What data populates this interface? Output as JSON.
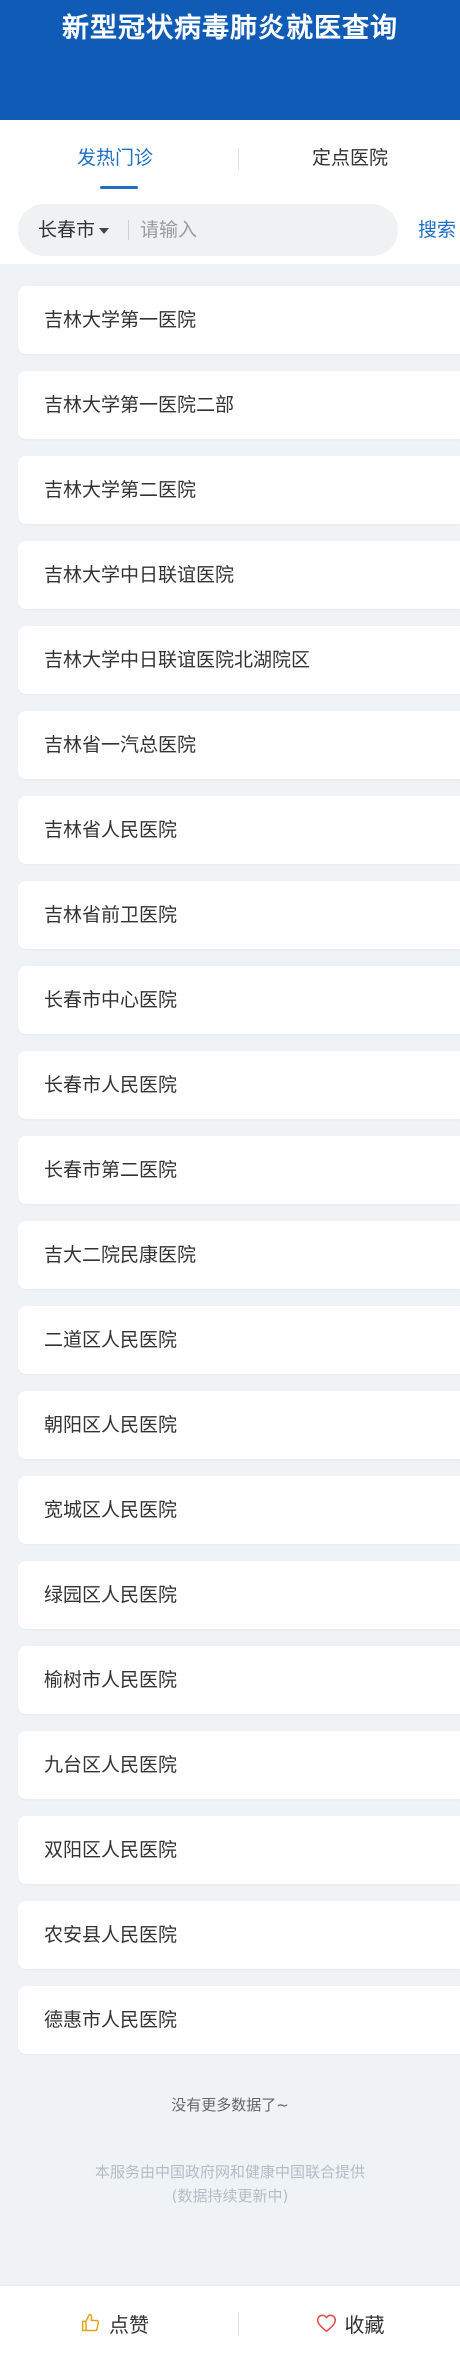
{
  "header": {
    "title": "新型冠状病毒肺炎就医查询"
  },
  "tabs": [
    {
      "label": "发热门诊",
      "active": true
    },
    {
      "label": "定点医院",
      "active": false
    }
  ],
  "search": {
    "city": "长春市",
    "placeholder": "请输入",
    "button_label": "搜索"
  },
  "hospitals": [
    "吉林大学第一医院",
    "吉林大学第一医院二部",
    "吉林大学第二医院",
    "吉林大学中日联谊医院",
    "吉林大学中日联谊医院北湖院区",
    "吉林省一汽总医院",
    "吉林省人民医院",
    "吉林省前卫医院",
    "长春市中心医院",
    "长春市人民医院",
    "长春市第二医院",
    "吉大二院民康医院",
    "二道区人民医院",
    "朝阳区人民医院",
    "宽城区人民医院",
    "绿园区人民医院",
    "榆树市人民医院",
    "九台区人民医院",
    "双阳区人民医院",
    "农安县人民医院",
    "德惠市人民医院"
  ],
  "footer": {
    "no_more": "没有更多数据了~",
    "note_line1": "本服务由中国政府网和健康中国联合提供",
    "note_line2": "(数据持续更新中)"
  },
  "bottom_bar": {
    "like_label": "点赞",
    "favorite_label": "收藏"
  },
  "colors": {
    "header_bg": "#0f5bb5",
    "accent": "#1f6fc6",
    "page_bg": "#f0f3f6"
  },
  "icons": {
    "like": "thumbs-up-icon",
    "favorite": "heart-icon",
    "dropdown": "caret-down-icon"
  }
}
